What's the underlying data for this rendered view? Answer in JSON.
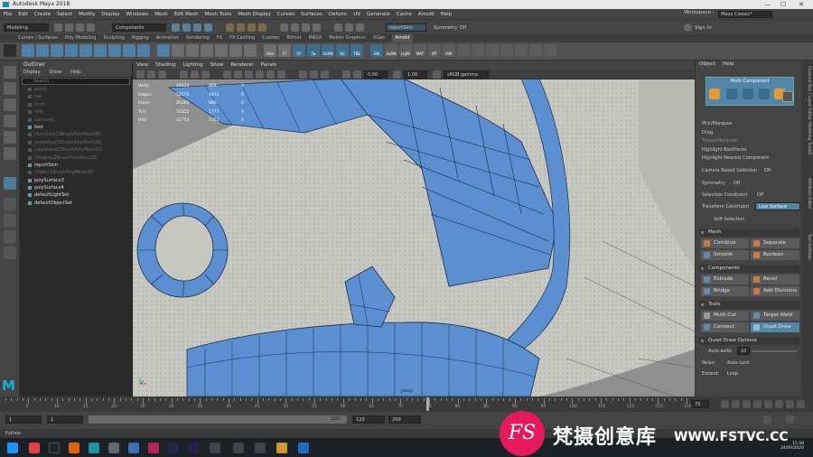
{
  "window": {
    "title": "Autodesk Maya 2018",
    "minimize": "—",
    "maximize": "☐",
    "close": "✕"
  },
  "menubar": {
    "items": [
      "File",
      "Edit",
      "Create",
      "Select",
      "Modify",
      "Display",
      "Windows",
      "Mesh",
      "Edit Mesh",
      "Mesh Tools",
      "Mesh Display",
      "Curves",
      "Surfaces",
      "Deform",
      "UV",
      "Generate",
      "Cache",
      "Arnold",
      "Help"
    ]
  },
  "workspace": {
    "label": "Workspace :",
    "value": "Maya Classic*"
  },
  "statusline": {
    "mode": "Modeling",
    "selection": "Components",
    "live": "reportSkin",
    "symmetry": "Symmetry: Off",
    "signin": "Sign In"
  },
  "shelf": {
    "tabs": [
      "Curves / Surfaces",
      "Poly Modeling",
      "Sculpting",
      "Rigging",
      "Animation",
      "Rendering",
      "FX",
      "FX Caching",
      "Custom",
      "Bifrost",
      "MASH",
      "Motion Graphics",
      "XGen",
      "Arnold"
    ],
    "active_tab": "Arnold",
    "icon_labels": [
      "Hist",
      "FT",
      "CP",
      "Tw",
      "SoftN",
      "RE",
      "TBE",
      "EW",
      "SoftN",
      "Light",
      "MAT",
      "MT",
      "MIR"
    ]
  },
  "outliner": {
    "title": "Outliner",
    "menu": [
      "Display",
      "Show",
      "Help"
    ],
    "search_placeholder": "Search...",
    "items": [
      {
        "name": "persp",
        "dim": true
      },
      {
        "name": "top",
        "dim": true
      },
      {
        "name": "front",
        "dim": true
      },
      {
        "name": "side",
        "dim": true
      },
      {
        "name": "camera1",
        "dim": true
      },
      {
        "name": "test",
        "dim": false
      },
      {
        "name": "|SumDisk|ZBrushPolyMesh3D",
        "dim": true
      },
      {
        "name": "|lowerJaw|ZBrushPolyMesh3D",
        "dim": true
      },
      {
        "name": "|upperJaw|ZBrushPolyMesh3D",
        "dim": true
      },
      {
        "name": "|Tongue|ZBrushPolyMesh3D",
        "dim": true
      },
      {
        "name": "reportSkin",
        "dim": false
      },
      {
        "name": "|Teeth|ZBrushPolyMesh3D",
        "dim": true
      },
      {
        "name": "polySurface3",
        "dim": false
      },
      {
        "name": "polySurface4",
        "dim": false
      },
      {
        "name": "defaultLightSet",
        "dim": false
      },
      {
        "name": "defaultObjectSet",
        "dim": false
      }
    ]
  },
  "viewport": {
    "menu": [
      "View",
      "Shading",
      "Lighting",
      "Show",
      "Renderer",
      "Panels"
    ],
    "field1": "0.00",
    "field2": "1.00",
    "colorspace": "sRGB gamma",
    "hud": [
      {
        "label": "Verts:",
        "a": "26423",
        "b": "969",
        "c": "0"
      },
      {
        "label": "Edges:",
        "a": "52576",
        "b": "1872",
        "c": "0"
      },
      {
        "label": "Faces:",
        "a": "26161",
        "b": "880",
        "c": "0"
      },
      {
        "label": "Tris:",
        "a": "52322",
        "b": "1777",
        "c": "0"
      },
      {
        "label": "UVs:",
        "a": "32752",
        "b": "2353",
        "c": "0"
      }
    ],
    "camera": "persp"
  },
  "rightpanel": {
    "tabs": [
      "Object",
      "Help"
    ],
    "multicomp": "Multi-Component",
    "options": {
      "pick_marquee": "Pick/Marquee",
      "drag": "Drag",
      "tweak": "Tweak/Marquee",
      "highlight_backfaces": "Highlight Backfaces",
      "highlight_nearest": "Highlight Nearest Component",
      "camera_sel_label": "Camera Based Selection",
      "camera_sel_value": "Off",
      "symmetry_label": "Symmetry",
      "symmetry_value": "Off",
      "selconstraint_label": "Selection Constraint",
      "selconstraint_value": "Off",
      "transconstraint_label": "Transform Constraint",
      "transconstraint_value": "Live Surface",
      "soft_selection": "Soft Selection"
    },
    "sections": {
      "mesh": "Mesh",
      "components": "Components",
      "tools": "Tools",
      "quad_draw": "Quad Draw Options"
    },
    "buttons": {
      "combine": "Combine",
      "separate": "Separate",
      "smooth": "Smooth",
      "boolean": "Boolean",
      "extrude": "Extrude",
      "bevel": "Bevel",
      "bridge": "Bridge",
      "add_divisions": "Add Divisions",
      "multicut": "Multi-Cut",
      "target_weld": "Target Weld",
      "connect": "Connect",
      "quad_draw": "Quad Draw"
    },
    "quad": {
      "autoweld_label": "Auto-weld:",
      "autoweld_value": "10",
      "relax_label": "Relax:",
      "relax_value": "Auto-Lock",
      "extend_label": "Extend:",
      "extend_value": "Loop"
    }
  },
  "sidebar_tabs": [
    "Channel Box / Layer Editor",
    "Modeling Toolkit",
    "Attribute Editor",
    "Tool Settings"
  ],
  "timeslider": {
    "ticks": [
      "5",
      "10",
      "15",
      "20",
      "25",
      "30",
      "35",
      "40",
      "45",
      "50",
      "55",
      "60",
      "65",
      "70",
      "75",
      "80",
      "85",
      "90",
      "95",
      "100",
      "105",
      "110",
      "115",
      "120"
    ],
    "current_frame": "75"
  },
  "range": {
    "start": "1",
    "start2": "1",
    "end": "120",
    "end2": "120",
    "end3": "200"
  },
  "cmdline": {
    "label": "Python"
  },
  "clock": {
    "time": "15:48",
    "date": "24/09/2020"
  },
  "watermark": {
    "logo": "FS",
    "cn": "梵摄创意库",
    "url": "WWW.FSTVC.CC"
  }
}
